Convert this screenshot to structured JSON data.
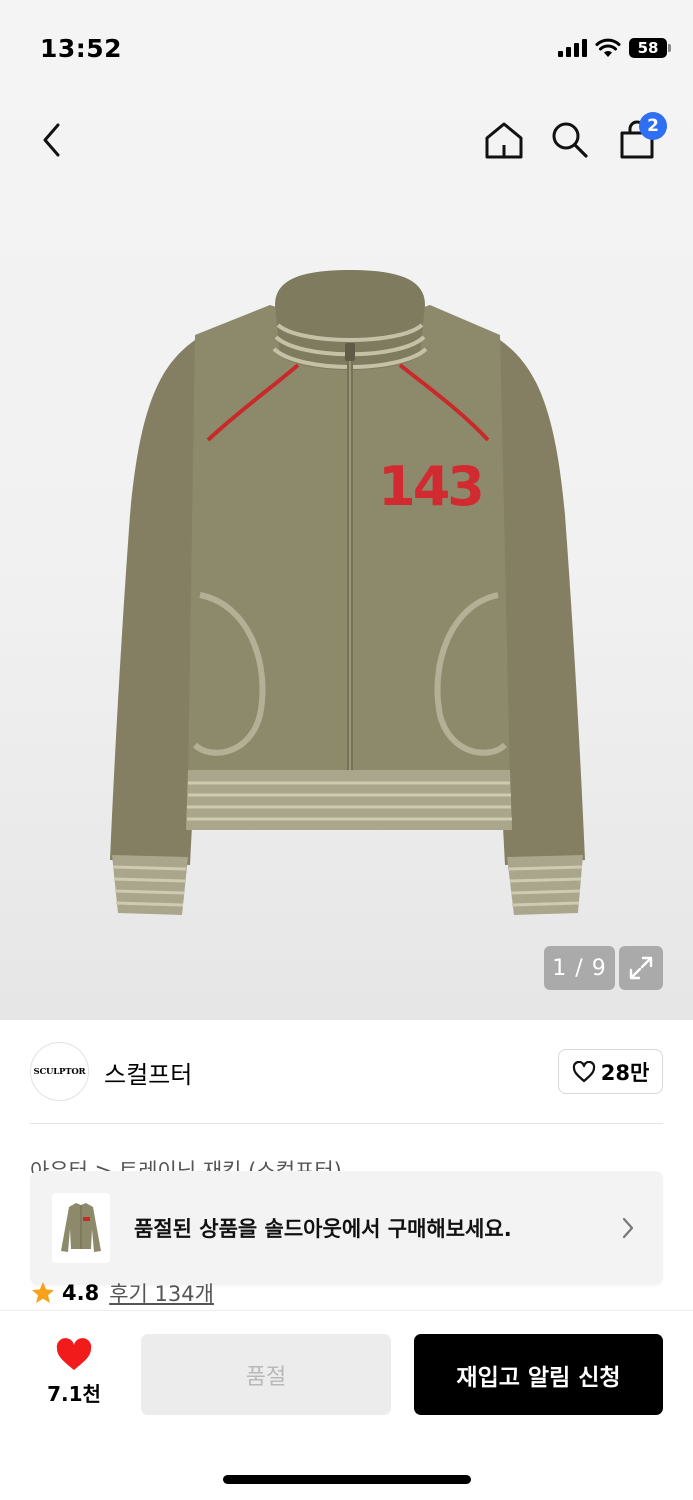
{
  "status_bar": {
    "time": "13:52",
    "battery": "58",
    "icons": [
      "signal-icon",
      "wifi-icon",
      "battery-icon"
    ]
  },
  "nav": {
    "icons": [
      "back-icon",
      "home-icon",
      "search-icon",
      "shopping-bag-icon"
    ],
    "cart_count": "2"
  },
  "product_image": {
    "patch_text": "143",
    "pager": "1 / 9"
  },
  "brand": {
    "logo_text": "SCULPTOR",
    "name": "스컬프터",
    "like_count": "28만"
  },
  "breadcrumb": "아우터 > 트레이닝 재킷 (스컬프터)",
  "soldout_banner": {
    "text": "품절된 상품을 솔드아웃에서 구매해보세요."
  },
  "rating": {
    "value": "4.8",
    "reviews": "후기 134개"
  },
  "bottom_bar": {
    "heart_count": "7.1천",
    "soldout_label": "품절",
    "restock_label": "재입고 알림 신청"
  },
  "colors": {
    "accent_blue": "#2f6ff3",
    "heart_red": "#f21b1b",
    "star_orange": "#f7a21b",
    "jacket_olive": "#8d8a6c",
    "piping_red": "#c82a2a"
  }
}
